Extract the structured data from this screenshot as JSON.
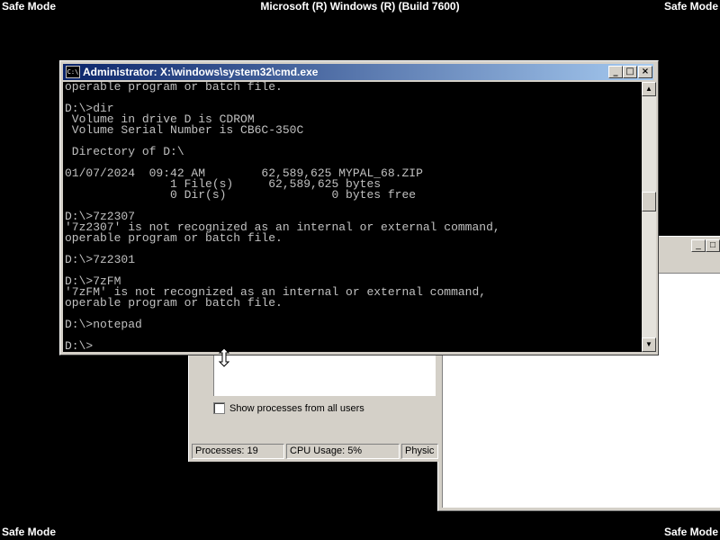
{
  "desktop": {
    "safe_mode": "Safe Mode",
    "build": "Microsoft (R) Windows (R) (Build 7600)"
  },
  "cmd": {
    "title": "Administrator: X:\\windows\\system32\\cmd.exe",
    "icon_text": "C:\\",
    "minimize": "_",
    "maximize": "□",
    "close": "×",
    "lines": [
      "operable program or batch file.",
      "",
      "D:\\>dir",
      " Volume in drive D is CDROM",
      " Volume Serial Number is CB6C-350C",
      "",
      " Directory of D:\\",
      "",
      "01/07/2024  09:42 AM        62,589,625 MYPAL_68.ZIP",
      "               1 File(s)     62,589,625 bytes",
      "               0 Dir(s)               0 bytes free",
      "",
      "D:\\>7z2307",
      "'7z2307' is not recognized as an internal or external command,",
      "operable program or batch file.",
      "",
      "D:\\>7z2301",
      "",
      "D:\\>7zFM",
      "'7zFM' is not recognized as an internal or external command,",
      "operable program or batch file.",
      "",
      "D:\\>notepad",
      "",
      "D:\\>"
    ],
    "scroll_up": "▲",
    "scroll_down": "▼"
  },
  "taskmgr": {
    "show_all": "Show processes from all users",
    "status": [
      "Processes: 19",
      "CPU Usage: 5%",
      "Physic"
    ]
  },
  "notepad": {
    "minimize": "_",
    "maximize": "□"
  },
  "icons": {
    "cursor": "vertical-resize-cursor"
  }
}
